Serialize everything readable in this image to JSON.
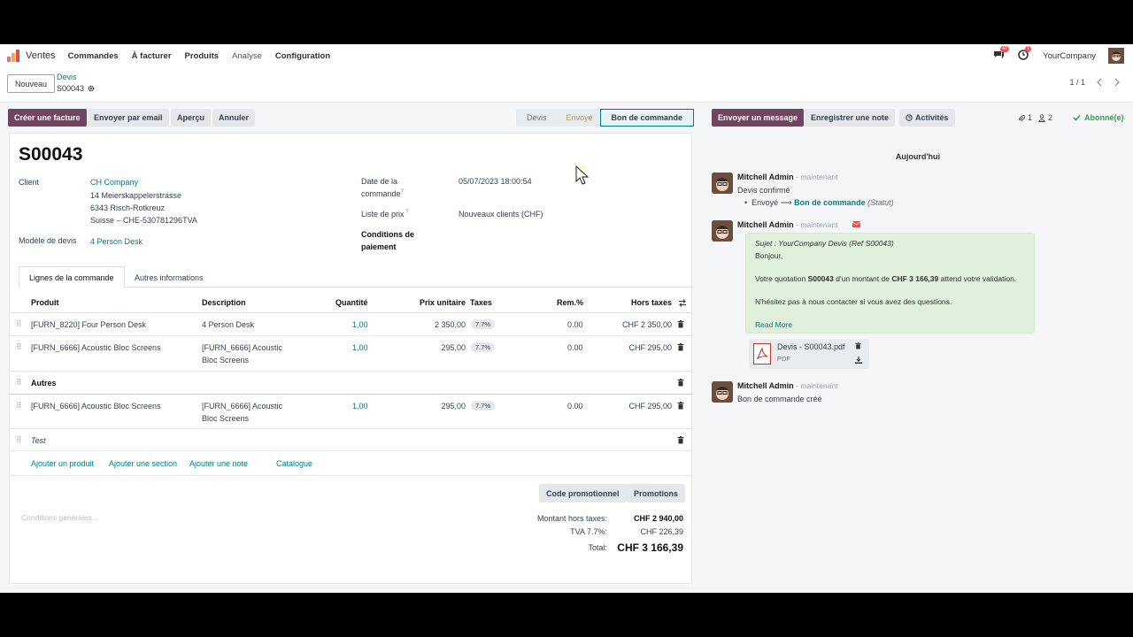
{
  "topnav": {
    "app_name": "Ventes",
    "menu": [
      "Commandes",
      "À facturer",
      "Produits",
      "Analyse",
      "Configuration"
    ],
    "chat_badge": "43",
    "activity_badge": "1",
    "company": "YourCompany"
  },
  "breadcrumb": {
    "new_button": "Nouveau",
    "parent": "Devis",
    "current": "S00043",
    "pager": "1 / 1"
  },
  "actions": {
    "create_invoice": "Créer une facture",
    "send_email": "Envoyer par email",
    "preview": "Aperçu",
    "cancel": "Annuler"
  },
  "status": {
    "stages": [
      "Devis",
      "Envoyé",
      "Bon de commande"
    ],
    "active": "Bon de commande"
  },
  "chatter_actions": {
    "send_message": "Envoyer un message",
    "log_note": "Enregistrer une note",
    "activities": "Activités",
    "attachments_count": "1",
    "followers_count": "2",
    "subscribed": "Abonné(e)"
  },
  "form": {
    "title": "S00043",
    "customer_label": "Client",
    "customer_name": "CH Company",
    "customer_address1": "14 Meierskappelerstrasse",
    "customer_address2": "6343 Risch-Rotkreuz",
    "customer_address3": "Suisse – CHE-530781296TVA",
    "template_label": "Modèle de devis",
    "template_value": "4 Person Desk",
    "date_label_1": "Date de la",
    "date_label_2": "commande",
    "date_value": "05/07/2023 18:00:54",
    "pricelist_label": "Liste de prix",
    "pricelist_value": "Nouveaux clients (CHF)",
    "payment_label_1": "Conditions de",
    "payment_label_2": "paiement"
  },
  "tabs": [
    "Lignes de la commande",
    "Autres informations"
  ],
  "table": {
    "headers": {
      "product": "Produit",
      "description": "Description",
      "quantity": "Quantité",
      "unit_price": "Prix unitaire",
      "taxes": "Taxes",
      "discount": "Rem.%",
      "subtotal": "Hors taxes"
    },
    "rows": [
      {
        "product": "[FURN_8220] Four Person Desk",
        "desc1": "4 Person Desk",
        "desc2": "",
        "qty": "1,00",
        "price": "2 350,00",
        "tax": "7.7%",
        "disc": "0.00",
        "subtotal": "CHF 2 350,00"
      },
      {
        "product": "[FURN_6666] Acoustic Bloc Screens",
        "desc1": "[FURN_6666] Acoustic",
        "desc2": "Bloc Screens",
        "qty": "1,00",
        "price": "295,00",
        "tax": "7.7%",
        "disc": "0.00",
        "subtotal": "CHF 295,00"
      },
      {
        "product": "[FURN_6666] Acoustic Bloc Screens",
        "desc1": "[FURN_6666] Acoustic",
        "desc2": "Bloc Screens",
        "qty": "1,00",
        "price": "295,00",
        "tax": "7.7%",
        "disc": "0.00",
        "subtotal": "CHF 295,00"
      }
    ],
    "section": "Autres",
    "note": "Test",
    "add_product": "Ajouter un produit",
    "add_section": "Ajouter une section",
    "add_note": "Ajouter une note",
    "catalog": "Catalogue"
  },
  "promo": {
    "code": "Code promotionnel",
    "promotions": "Promotions"
  },
  "terms_placeholder": "Conditions générales...",
  "totals": {
    "untaxed_label": "Montant hors taxes:",
    "untaxed_value": "CHF 2 940,00",
    "vat_label": "TVA 7.7%:",
    "vat_value": "CHF 226,39",
    "total_label": "Total:",
    "total_value": "CHF 3 166,39"
  },
  "chatter": {
    "date_separator": "Aujourd'hui",
    "messages": [
      {
        "author": "Mitchell Admin",
        "time": "- maintenant",
        "text": "Devis confirmé",
        "from": "Envoyé",
        "to": "Bon de commande",
        "field": "(Statut)"
      },
      {
        "author": "Mitchell Admin",
        "time": "- maintenant",
        "subject": "Sujet : YourCompany Devis (Ref S00043)",
        "greeting": "Bonjour,",
        "body_pre": "Votre quotation",
        "body_ref": "S00043",
        "body_mid": "d'un montant de",
        "body_amount": "CHF 3 166,39",
        "body_post": "attend votre validation.",
        "closing": "N'hésitez pas à nous contacter si vous avez des questions.",
        "read_more": "Read More",
        "attachment_name": "Devis - S00043.pdf",
        "attachment_type": "PDF"
      },
      {
        "author": "Mitchell Admin",
        "time": "- maintenant",
        "text": "Bon de commande créé"
      }
    ]
  }
}
